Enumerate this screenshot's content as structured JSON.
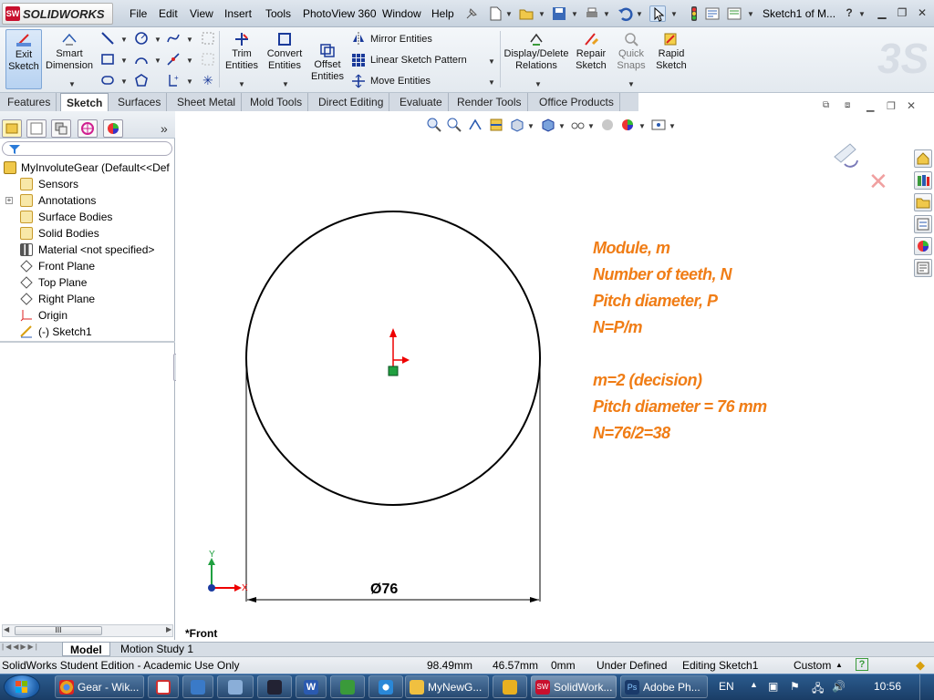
{
  "app": {
    "logo_text": "SOLIDWORKS",
    "document_title": "Sketch1 of M...",
    "help_icon": "question-icon"
  },
  "menu": [
    "File",
    "Edit",
    "View",
    "Insert",
    "Tools",
    "PhotoView 360",
    "Window",
    "Help"
  ],
  "command_manager": {
    "exit_sketch": "Exit Sketch",
    "smart_dimension": "Smart Dimension",
    "trim_entities": "Trim Entities",
    "convert_entities": "Convert Entities",
    "offset_entities": "Offset Entities",
    "mirror_entities": "Mirror Entities",
    "linear_sketch_pattern": "Linear Sketch Pattern",
    "move_entities": "Move Entities",
    "display_delete_relations": "Display/Delete Relations",
    "repair_sketch": "Repair Sketch",
    "quick_snaps": "Quick Snaps",
    "rapid_sketch": "Rapid Sketch"
  },
  "tabs": [
    "Features",
    "Sketch",
    "Surfaces",
    "Sheet Metal",
    "Mold Tools",
    "Direct Editing",
    "Evaluate",
    "Render Tools",
    "Office Products"
  ],
  "active_tab": "Sketch",
  "feature_tree": {
    "root": "MyInvoluteGear  (Default<<Def",
    "items": [
      {
        "label": "Sensors",
        "icon": "sensor-icon"
      },
      {
        "label": "Annotations",
        "icon": "annotation-icon"
      },
      {
        "label": "Surface Bodies",
        "icon": "surface-bodies-icon"
      },
      {
        "label": "Solid Bodies",
        "icon": "solid-bodies-icon"
      },
      {
        "label": "Material <not specified>",
        "icon": "material-icon"
      },
      {
        "label": "Front Plane",
        "icon": "plane-icon"
      },
      {
        "label": "Top Plane",
        "icon": "plane-icon"
      },
      {
        "label": "Right Plane",
        "icon": "plane-icon"
      },
      {
        "label": "Origin",
        "icon": "origin-icon"
      },
      {
        "label": "(-) Sketch1",
        "icon": "sketch-icon"
      }
    ],
    "scroll_thumb": "III"
  },
  "graphics": {
    "view_label": "*Front",
    "dimension": "Ø76",
    "triad_x": "X",
    "triad_y": "Y",
    "notes": [
      "Module, m",
      "Number of teeth, N",
      "Pitch diameter, P",
      "N=P/m",
      "",
      "m=2 (decision)",
      "Pitch diameter = 76 mm",
      "N=76/2=38"
    ]
  },
  "bottom_tabs": [
    "Model",
    "Motion Study 1"
  ],
  "status": {
    "edition": "SolidWorks Student Edition - Academic Use Only",
    "x": "98.49mm",
    "y": "46.57mm",
    "z": "0mm",
    "definition": "Under Defined",
    "mode": "Editing Sketch1",
    "units": "Custom"
  },
  "taskbar": {
    "buttons": [
      {
        "label": "Gear - Wik...",
        "color": "#e8a020"
      },
      {
        "label": "",
        "color": "#d03030"
      },
      {
        "label": "",
        "color": "#3a7ac8"
      },
      {
        "label": "",
        "color": "#5a8ab8"
      },
      {
        "label": "",
        "color": "#2a5ab0"
      },
      {
        "label": "",
        "color": "#3a9a3a"
      },
      {
        "label": "",
        "color": "#2a88d8"
      },
      {
        "label": "MyNewG...",
        "color": "#f0c040"
      },
      {
        "label": "",
        "color": "#e8b020"
      },
      {
        "label": "SolidWork...",
        "color": "#c8102e"
      },
      {
        "label": "Adobe Ph...",
        "color": "#1a3a6a"
      }
    ],
    "language": "EN",
    "clock": "10:56"
  },
  "colors": {
    "note_orange": "#f07d16",
    "sketch_line": "#000000"
  }
}
